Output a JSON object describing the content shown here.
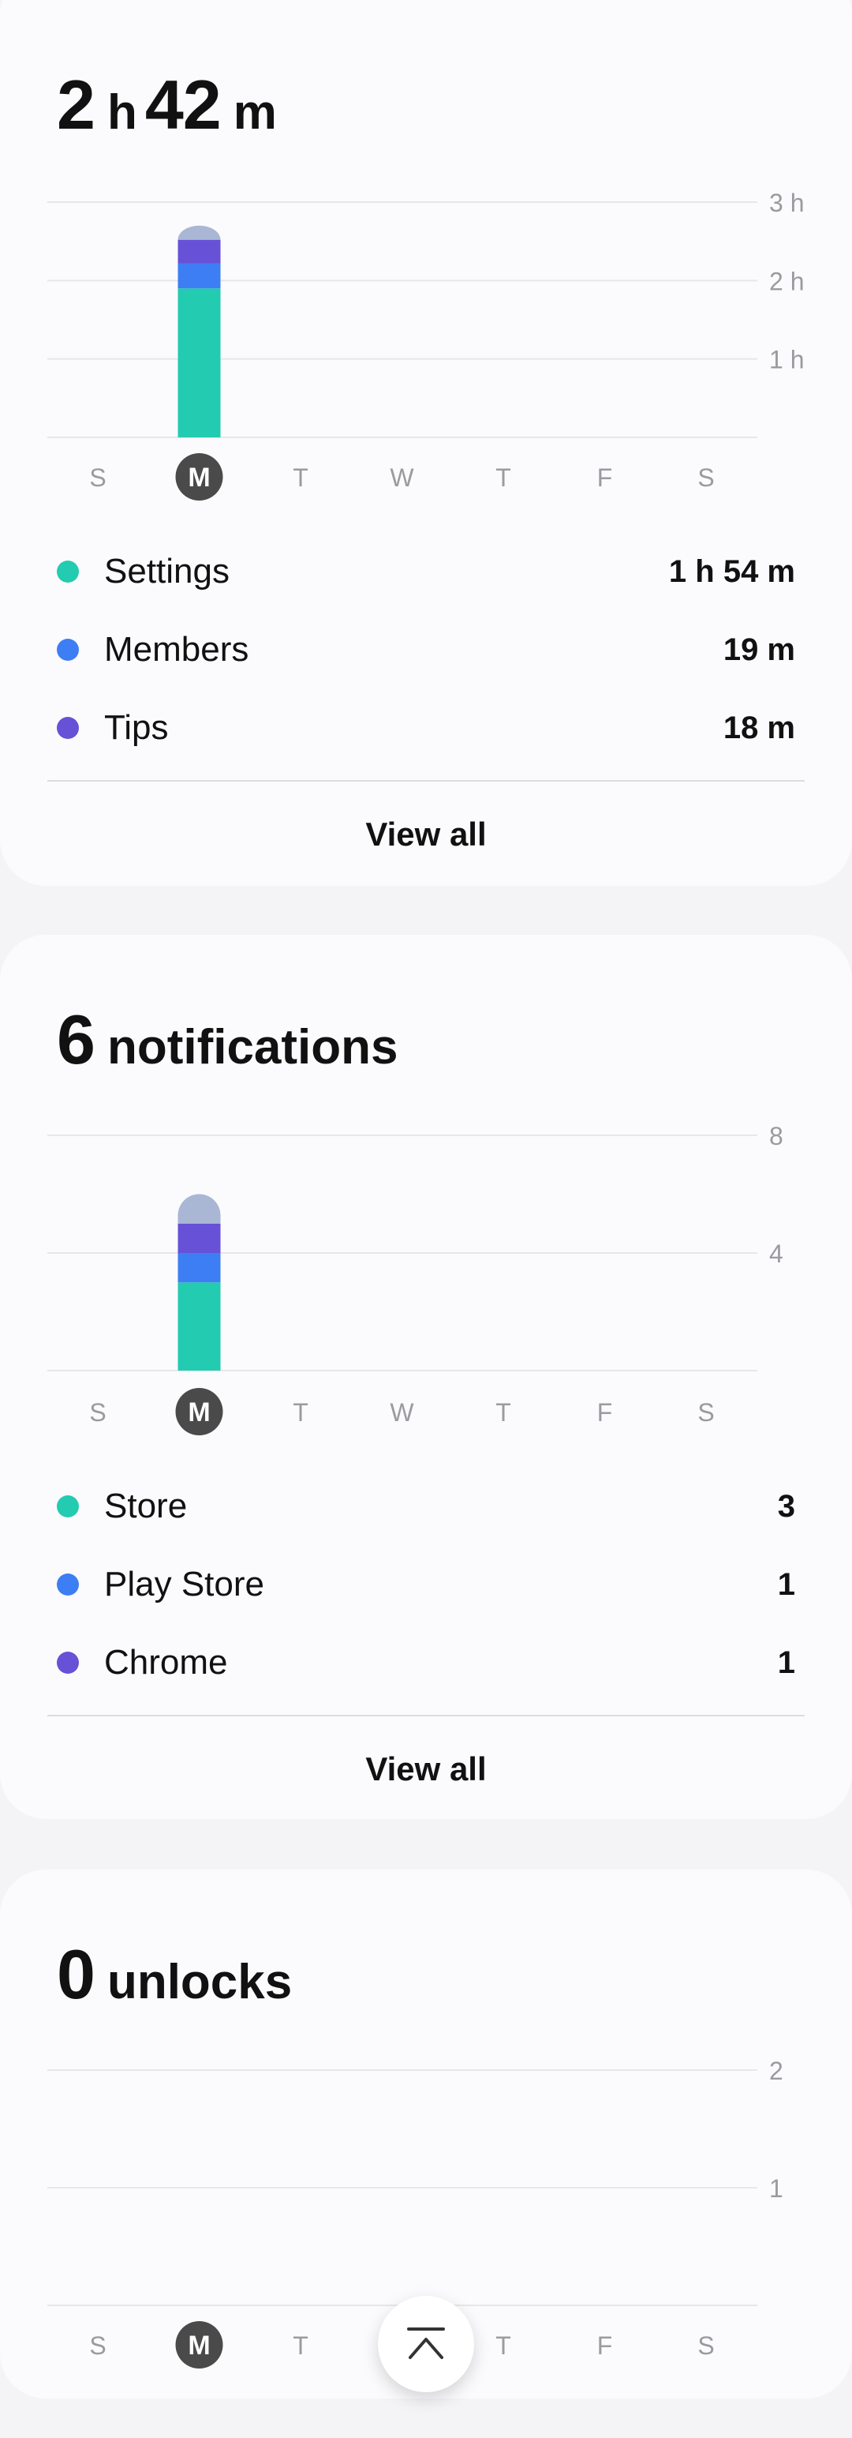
{
  "screen_time": {
    "headline": {
      "hours_value": "2",
      "hours_unit": "h",
      "minutes_value": "42",
      "minutes_unit": "m"
    },
    "chart_data": {
      "type": "bar",
      "stacked": true,
      "categories": [
        "S",
        "M",
        "T",
        "W",
        "T",
        "F",
        "S"
      ],
      "selected_category": "M",
      "y_ticks": [
        "1 h",
        "2 h",
        "3 h"
      ],
      "ylim": [
        0,
        3
      ],
      "y_unit": "hours",
      "series": [
        {
          "name": "Settings",
          "color": "#23cbb1",
          "values": [
            0,
            1.9,
            0,
            0,
            0,
            0,
            0
          ]
        },
        {
          "name": "Members",
          "color": "#3d7ef5",
          "values": [
            0,
            0.32,
            0,
            0,
            0,
            0,
            0
          ]
        },
        {
          "name": "Tips",
          "color": "#6751d6",
          "values": [
            0,
            0.3,
            0,
            0,
            0,
            0,
            0
          ]
        },
        {
          "color": "#a9b7d4",
          "values": [
            0,
            0.18,
            0,
            0,
            0,
            0,
            0
          ]
        }
      ]
    },
    "legend": [
      {
        "label": "Settings",
        "value": "1 h 54 m",
        "color": "#23cbb1"
      },
      {
        "label": "Members",
        "value": "19 m",
        "color": "#3d7ef5"
      },
      {
        "label": "Tips",
        "value": "18 m",
        "color": "#6751d6"
      }
    ],
    "view_all_label": "View all"
  },
  "notifications": {
    "headline": {
      "count": "6",
      "label": "notifications"
    },
    "chart_data": {
      "type": "bar",
      "stacked": true,
      "categories": [
        "S",
        "M",
        "T",
        "W",
        "T",
        "F",
        "S"
      ],
      "selected_category": "M",
      "y_ticks": [
        "4",
        "8"
      ],
      "ylim": [
        0,
        8
      ],
      "series": [
        {
          "name": "Store",
          "color": "#23cbb1",
          "values": [
            0,
            3,
            0,
            0,
            0,
            0,
            0
          ]
        },
        {
          "name": "Play Store",
          "color": "#3d7ef5",
          "values": [
            0,
            1,
            0,
            0,
            0,
            0,
            0
          ]
        },
        {
          "name": "Chrome",
          "color": "#6751d6",
          "values": [
            0,
            1,
            0,
            0,
            0,
            0,
            0
          ]
        },
        {
          "color": "#a9b7d4",
          "values": [
            0,
            1,
            0,
            0,
            0,
            0,
            0
          ]
        }
      ]
    },
    "legend": [
      {
        "label": "Store",
        "value": "3",
        "color": "#23cbb1"
      },
      {
        "label": "Play Store",
        "value": "1",
        "color": "#3d7ef5"
      },
      {
        "label": "Chrome",
        "value": "1",
        "color": "#6751d6"
      }
    ],
    "view_all_label": "View all"
  },
  "unlocks": {
    "headline": {
      "count": "0",
      "label": "unlocks"
    },
    "chart_data": {
      "type": "bar",
      "categories": [
        "S",
        "M",
        "T",
        "W",
        "T",
        "F",
        "S"
      ],
      "selected_category": "M",
      "y_ticks": [
        "1",
        "2"
      ],
      "ylim": [
        0,
        2
      ],
      "series": [
        {
          "color": "#23cbb1",
          "values": [
            0,
            0,
            0,
            0,
            0,
            0,
            0
          ]
        }
      ]
    }
  },
  "scroll_top": {
    "icon": "chevron-up-to-top-icon"
  },
  "colors": {
    "selected_day_bg": "#4a4a4a",
    "axis_text": "#9b9b9f",
    "grid": "#e7e7ea"
  }
}
